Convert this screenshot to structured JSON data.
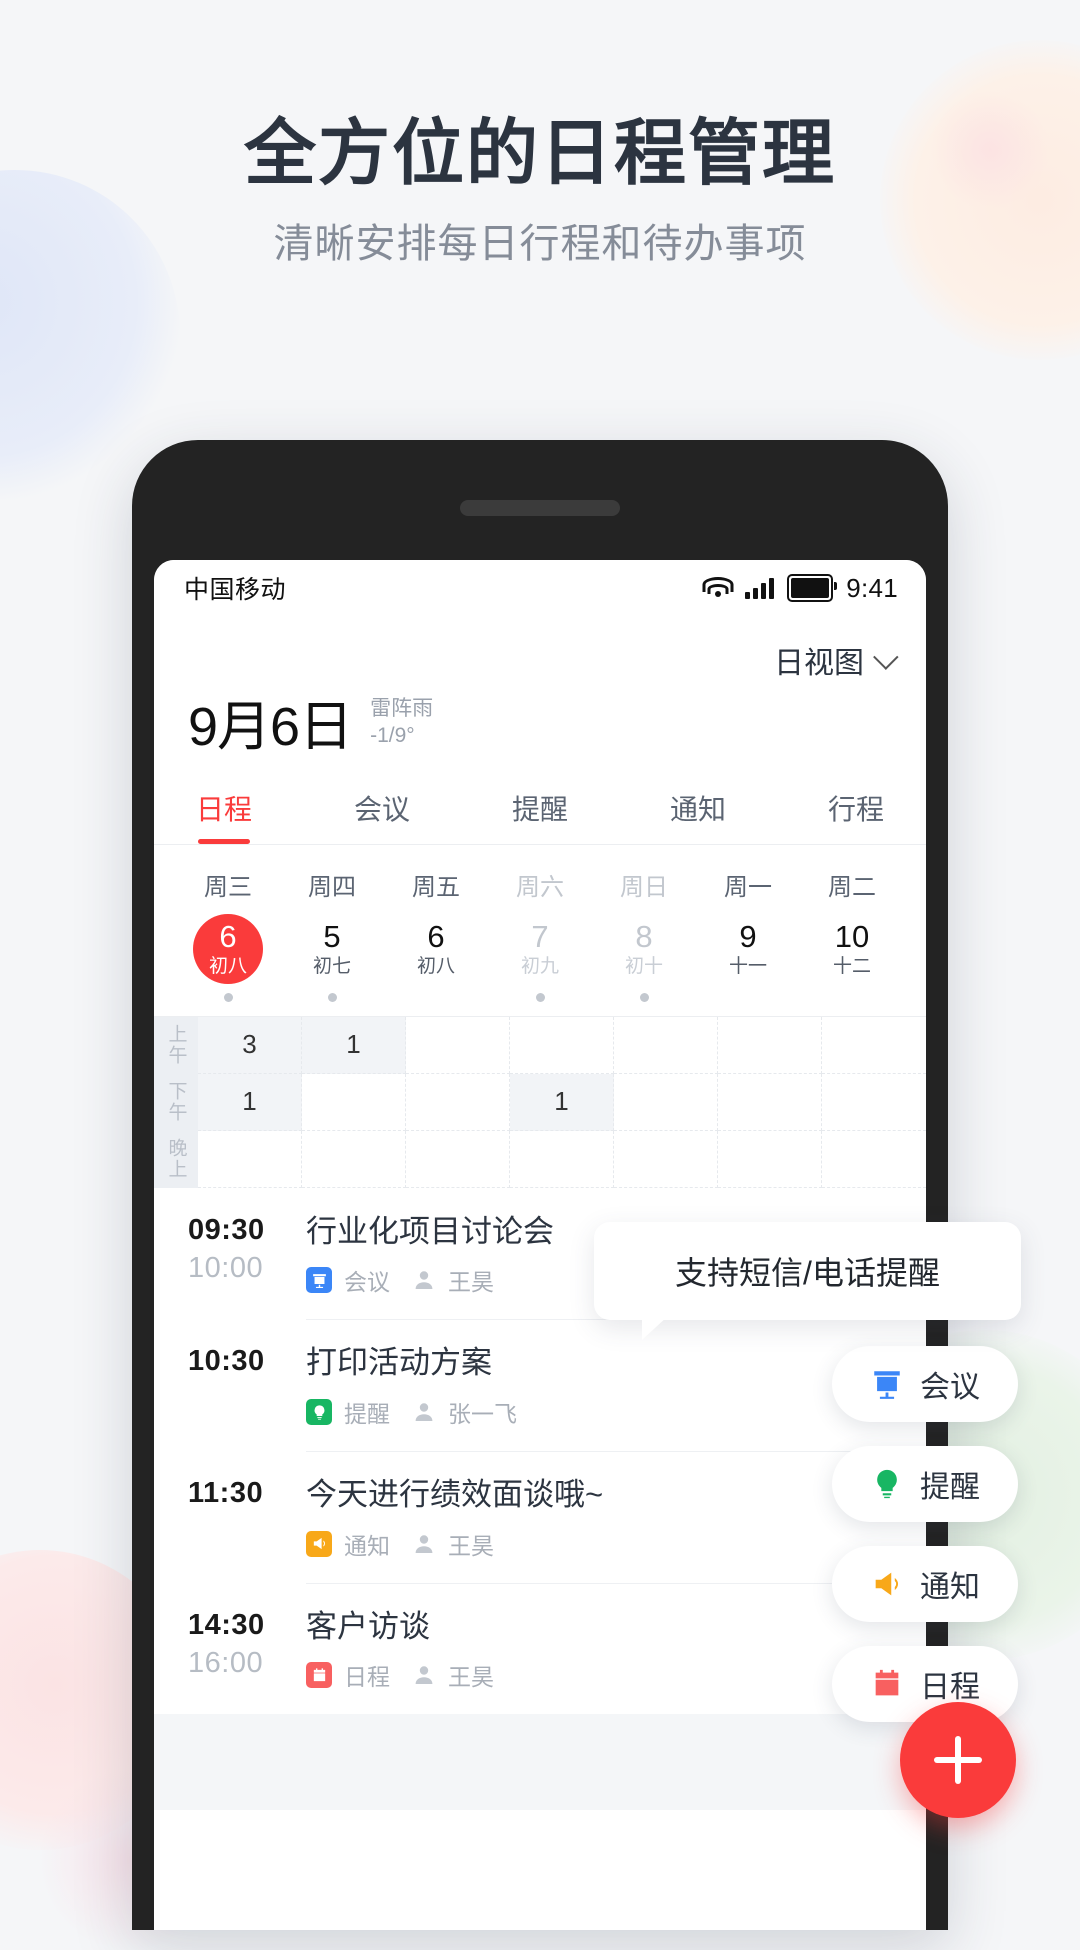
{
  "hero": {
    "title": "全方位的日程管理",
    "subtitle": "清晰安排每日行程和待办事项"
  },
  "statusbar": {
    "carrier": "中国移动",
    "time": "9:41",
    "icons": [
      "wifi-icon",
      "cellular-signal-icon",
      "battery-icon"
    ]
  },
  "header": {
    "view_selector": "日视图",
    "date": "9月6日",
    "weather_condition": "雷阵雨",
    "weather_temp": "-1/9°"
  },
  "tabs": [
    {
      "label": "日程",
      "active": true
    },
    {
      "label": "会议",
      "active": false
    },
    {
      "label": "提醒",
      "active": false
    },
    {
      "label": "通知",
      "active": false
    },
    {
      "label": "行程",
      "active": false
    }
  ],
  "week": [
    {
      "dow": "周三",
      "num": "6",
      "lunar": "初八",
      "selected": true,
      "dim": false,
      "dot": true
    },
    {
      "dow": "周四",
      "num": "5",
      "lunar": "初七",
      "selected": false,
      "dim": false,
      "dot": true
    },
    {
      "dow": "周五",
      "num": "6",
      "lunar": "初八",
      "selected": false,
      "dim": false,
      "dot": false
    },
    {
      "dow": "周六",
      "num": "7",
      "lunar": "初九",
      "selected": false,
      "dim": true,
      "dot": true
    },
    {
      "dow": "周日",
      "num": "8",
      "lunar": "初十",
      "selected": false,
      "dim": true,
      "dot": true
    },
    {
      "dow": "周一",
      "num": "9",
      "lunar": "十一",
      "selected": false,
      "dim": false,
      "dot": false
    },
    {
      "dow": "周二",
      "num": "10",
      "lunar": "十二",
      "selected": false,
      "dim": false,
      "dot": false
    }
  ],
  "grid": {
    "row_labels": [
      "上午",
      "下午",
      "晚上"
    ],
    "rows": [
      [
        "3",
        "1",
        "",
        "",
        "",
        "",
        ""
      ],
      [
        "1",
        "",
        "",
        "1",
        "",
        "",
        ""
      ],
      [
        "",
        "",
        "",
        "",
        "",
        "",
        ""
      ]
    ]
  },
  "events": [
    {
      "start": "09:30",
      "end": "10:00",
      "title": "行业化项目讨论会",
      "type": "会议",
      "type_icon": "meeting-icon",
      "type_color": "#3b86f7",
      "owner": "王昊"
    },
    {
      "start": "10:30",
      "end": "",
      "title": "打印活动方案",
      "type": "提醒",
      "type_icon": "bulb-icon",
      "type_color": "#18b663",
      "owner": "张一飞"
    },
    {
      "start": "11:30",
      "end": "",
      "title": "今天进行绩效面谈哦~",
      "type": "通知",
      "type_icon": "megaphone-icon",
      "type_color": "#f8a819",
      "owner": "王昊"
    },
    {
      "start": "14:30",
      "end": "16:00",
      "title": "客户访谈",
      "type": "日程",
      "type_icon": "calendar-icon",
      "type_color": "#f86060",
      "owner": "王昊"
    }
  ],
  "tooltip": {
    "text": "支持短信/电话提醒"
  },
  "pills": [
    {
      "label": "会议",
      "icon": "meeting-icon",
      "color": "#3b86f7"
    },
    {
      "label": "提醒",
      "icon": "bulb-icon",
      "color": "#18b663"
    },
    {
      "label": "通知",
      "icon": "megaphone-icon",
      "color": "#f8a819"
    },
    {
      "label": "日程",
      "icon": "calendar-icon",
      "color": "#f86060"
    }
  ],
  "fab": {
    "icon": "plus-icon",
    "color": "#fa3b3b"
  },
  "colors": {
    "accent_red": "#fa3b3b",
    "title_dark": "#2c3440",
    "muted": "#9aa1ac",
    "page_bg": "#f5f6f8"
  }
}
